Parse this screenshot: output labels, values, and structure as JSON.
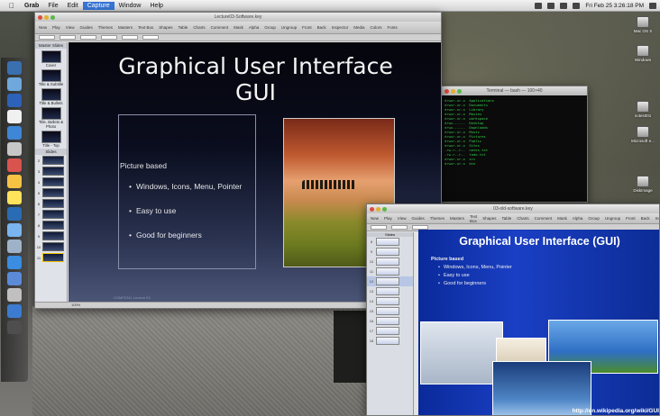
{
  "menubar": {
    "apple": "",
    "items": [
      "Grab",
      "File",
      "Edit",
      "Capture",
      "Window",
      "Help"
    ],
    "active_item": "Capture",
    "clock": "Fri Feb 25  3:26:18 PM"
  },
  "keynote": {
    "window_title": "Lecture03-Software.key",
    "toolbar_items": [
      "New",
      "Play",
      "View",
      "Guides",
      "Themes",
      "Masters",
      "Text Box",
      "Shapes",
      "Table",
      "Charts",
      "Comment",
      "Mask",
      "Alpha",
      "Group",
      "Ungroup",
      "Front",
      "Back",
      "Inspector",
      "Media",
      "Colors",
      "Fonts"
    ],
    "nav_header": "Master Slides",
    "masters": [
      "Cover",
      "Title & Subtitle",
      "Title & Bullets",
      "Title, Bullets & Photo",
      "Title - Top"
    ],
    "slides_header": "Slides",
    "slide_numbers": [
      "2",
      "3",
      "4",
      "5",
      "6",
      "7",
      "8",
      "9",
      "10",
      "11"
    ],
    "zoom": "100%",
    "slide": {
      "title_line1": "Graphical User Interface",
      "title_line2": "GUI",
      "heading": "Picture based",
      "bullets": [
        "Windows, Icons, Menu, Pointer",
        "Easy to use",
        "Good for beginners"
      ],
      "footer": "COMP2311 Lecture 03"
    }
  },
  "terminal": {
    "window_title": "Terminal — bash — 100×40",
    "lines": [
      "drwxr-xr-x  Applications",
      "drwxr-xr-x  Documents",
      "drwxr-xr-x  Library",
      "drwxr-xr-x  Movies",
      "drwxr-xr-x  workspace",
      "",
      "drwx------  Desktop",
      "drwx------  Downloads",
      "drwxr-xr-x  Music",
      "drwxr-xr-x  Pictures",
      "drwxr-xr-x  Public",
      "drwxr-xr-x  Sites",
      "-rw-r--r--  notes.txt",
      "-rw-r--r--  todo.txt",
      "drwxr-xr-x  src",
      "drwxr-xr-x  bin"
    ]
  },
  "keynote2": {
    "window_title": "03-old-software.key",
    "nav_header": "Slides",
    "slide_numbers": [
      "8",
      "9",
      "10",
      "11",
      "12",
      "13",
      "14",
      "15",
      "16",
      "17",
      "18"
    ],
    "slide": {
      "title": "Graphical User Interface (GUI)",
      "heading": "Picture based",
      "bullets": [
        "Windows, Icons, Menu, Pointer",
        "Easy to use",
        "Good for beginners"
      ],
      "url": "http://en.wikipedia.org/wiki/GUI"
    }
  },
  "desktop_icons": [
    "Mac OS X",
    "Windows",
    "notes001",
    "Microsoft e...",
    "DiskImage"
  ],
  "dock_colors": [
    "#3a6fb0",
    "#6fa8dc",
    "#2d62b8",
    "#f0f0f0",
    "#3e86d6",
    "#c7c7c7",
    "#d9534f",
    "#f6c244",
    "#ffe35a",
    "#2a6cb3",
    "#7ab5f0",
    "#9fb3c8",
    "#3a8de0",
    "#5b8ad8",
    "#c0c0c0",
    "#3c7bd0",
    "#4e4e4e"
  ]
}
